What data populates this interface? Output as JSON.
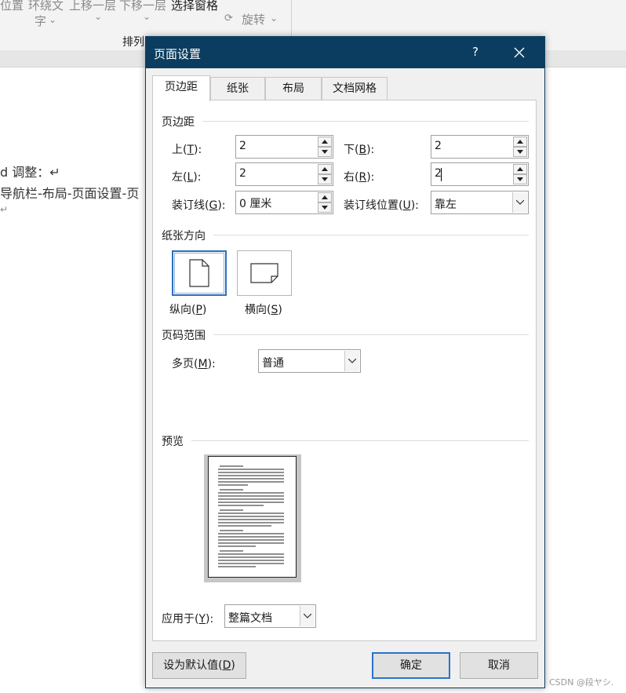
{
  "ribbon": {
    "items": [
      "位置",
      "环绕文",
      "字",
      "上移一层",
      "下移一层",
      "选择窗格",
      "旋转",
      "排列"
    ]
  },
  "document": {
    "lines": [
      "d 调整：↵",
      "导航栏-布局-页面设置-页",
      "↵"
    ]
  },
  "dialog": {
    "title": "页面设置",
    "help": "?",
    "tabs": [
      {
        "label": "页边距",
        "active": true
      },
      {
        "label": "纸张",
        "active": false
      },
      {
        "label": "布局",
        "active": false
      },
      {
        "label": "文档网格",
        "active": false
      }
    ],
    "margins": {
      "section": "页边距",
      "top_label": "上(T):",
      "top_mnemonic": "T",
      "top_value": "2",
      "bottom_label": "下(B):",
      "bottom_mnemonic": "B",
      "bottom_value": "2",
      "left_label": "左(L):",
      "left_mnemonic": "L",
      "left_value": "2",
      "right_label": "右(R):",
      "right_mnemonic": "R",
      "right_value": "2",
      "gutter_label": "装订线(G):",
      "gutter_mnemonic": "G",
      "gutter_value": "0 厘米",
      "gutter_pos_label": "装订线位置(U):",
      "gutter_pos_mnemonic": "U",
      "gutter_pos_value": "靠左"
    },
    "orientation": {
      "section": "纸张方向",
      "portrait": "纵向(P)",
      "portrait_mnemonic": "P",
      "landscape": "横向(S)",
      "landscape_mnemonic": "S",
      "selected": "portrait"
    },
    "pages": {
      "section": "页码范围",
      "multiple_label": "多页(M):",
      "multiple_mnemonic": "M",
      "multiple_value": "普通"
    },
    "preview": {
      "section": "预览"
    },
    "apply": {
      "label": "应用于(Y):",
      "mnemonic": "Y",
      "value": "整篇文档"
    },
    "buttons": {
      "default": "设为默认值(D)",
      "default_mnemonic": "D",
      "ok": "确定",
      "cancel": "取消"
    }
  },
  "watermark": "CSDN @段ヤシ."
}
